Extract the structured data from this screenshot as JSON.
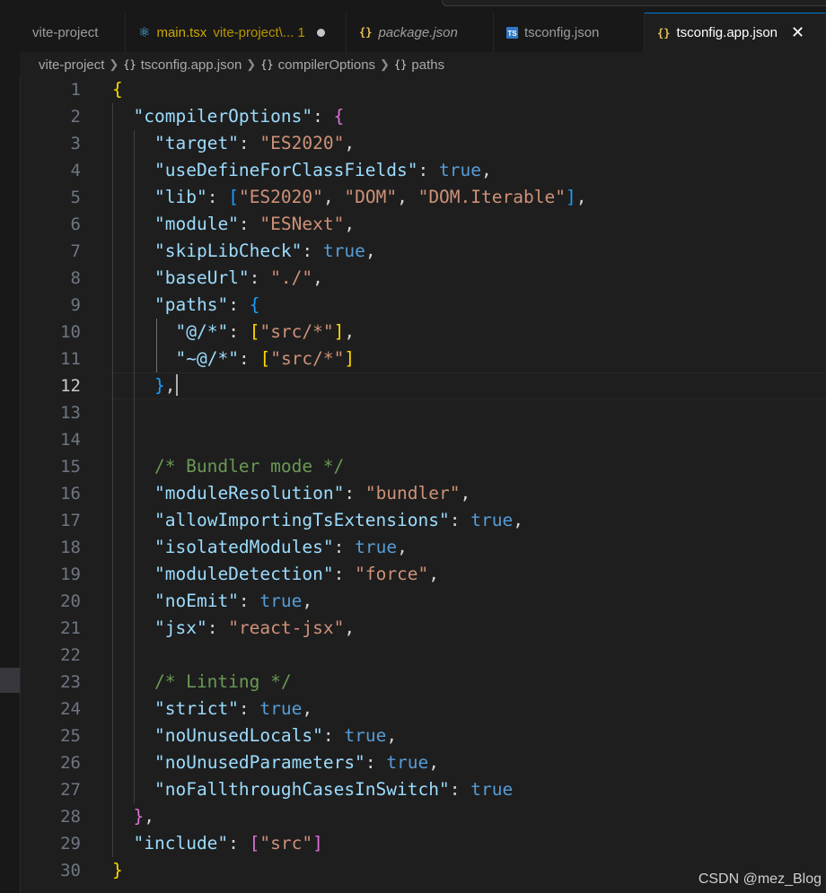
{
  "tabs": [
    {
      "label": "vite-project",
      "icon": "none",
      "active": false
    },
    {
      "label": "main.tsx",
      "suffix": "vite-project\\... 1",
      "icon": "react-icon",
      "active": false,
      "modified": true
    },
    {
      "label": "package.json",
      "icon": "json-braces-icon",
      "active": false
    },
    {
      "label": "tsconfig.json",
      "icon": "typescript-icon",
      "active": false
    },
    {
      "label": "tsconfig.app.json",
      "icon": "json-braces-icon",
      "active": true
    }
  ],
  "breadcrumb": {
    "project": "vite-project",
    "file": "tsconfig.app.json",
    "node1": "compilerOptions",
    "node2": "paths",
    "icon_text": "{}"
  },
  "editor": {
    "current_line": 12,
    "line_numbers": [
      "1",
      "2",
      "3",
      "4",
      "5",
      "6",
      "7",
      "8",
      "9",
      "10",
      "11",
      "12",
      "13",
      "14",
      "15",
      "16",
      "17",
      "18",
      "19",
      "20",
      "21",
      "22",
      "23",
      "24",
      "25",
      "26",
      "27",
      "28",
      "29",
      "30"
    ],
    "lines": [
      "{",
      "  \"compilerOptions\": {",
      "    \"target\": \"ES2020\",",
      "    \"useDefineForClassFields\": true,",
      "    \"lib\": [\"ES2020\", \"DOM\", \"DOM.Iterable\"],",
      "    \"module\": \"ESNext\",",
      "    \"skipLibCheck\": true,",
      "    \"baseUrl\": \"./\",",
      "    \"paths\": {",
      "      \"@/*\": [\"src/*\"],",
      "      \"~@/*\": [\"src/*\"]",
      "    },",
      "",
      "",
      "    /* Bundler mode */",
      "    \"moduleResolution\": \"bundler\",",
      "    \"allowImportingTsExtensions\": true,",
      "    \"isolatedModules\": true,",
      "    \"moduleDetection\": \"force\",",
      "    \"noEmit\": true,",
      "    \"jsx\": \"react-jsx\",",
      "",
      "    /* Linting */",
      "    \"strict\": true,",
      "    \"noUnusedLocals\": true,",
      "    \"noUnusedParameters\": true,",
      "    \"noFallthroughCasesInSwitch\": true",
      "  },",
      "  \"include\": [\"src\"]",
      "}"
    ]
  },
  "watermark": "CSDN @mez_Blog",
  "colors": {
    "background": "#1e1e1e",
    "key": "#9cdcfe",
    "string": "#ce9178",
    "boolean": "#569cd6",
    "comment": "#6a9955",
    "bracket_1": "#ffd700",
    "bracket_2": "#da70d6",
    "bracket_3": "#179fff"
  }
}
